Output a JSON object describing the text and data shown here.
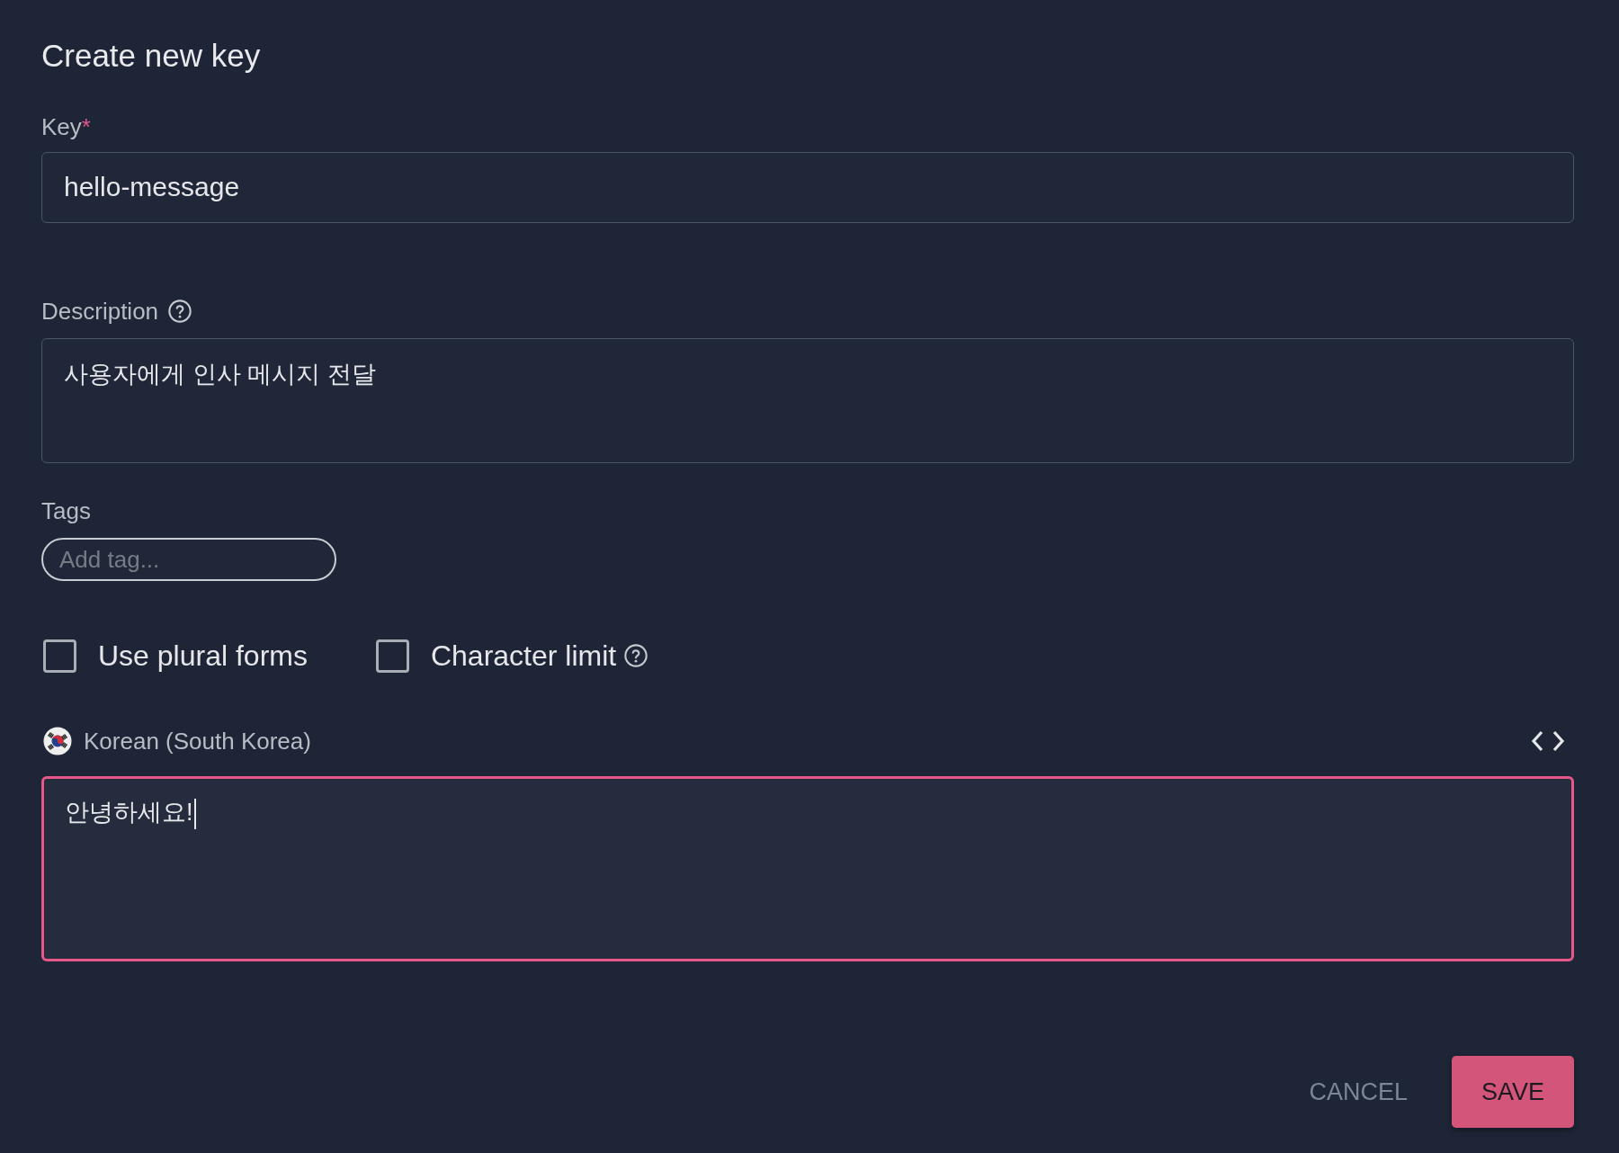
{
  "dialog": {
    "title": "Create new key",
    "key_field": {
      "label": "Key",
      "required_mark": "*",
      "value": "hello-message"
    },
    "description_field": {
      "label": "Description",
      "help": true,
      "value": "사용자에게 인사 메시지 전달"
    },
    "tags_field": {
      "label": "Tags",
      "placeholder": "Add tag..."
    },
    "options": [
      {
        "label": "Use plural forms",
        "checked": false,
        "help": false
      },
      {
        "label": "Character limit",
        "checked": false,
        "help": true
      }
    ],
    "translation": {
      "language": "Korean (South Korea)",
      "value": "안녕하세요!",
      "focused": true
    },
    "buttons": [
      {
        "label": "CANCEL",
        "kind": "text"
      },
      {
        "label": "SAVE",
        "kind": "primary"
      }
    ]
  }
}
